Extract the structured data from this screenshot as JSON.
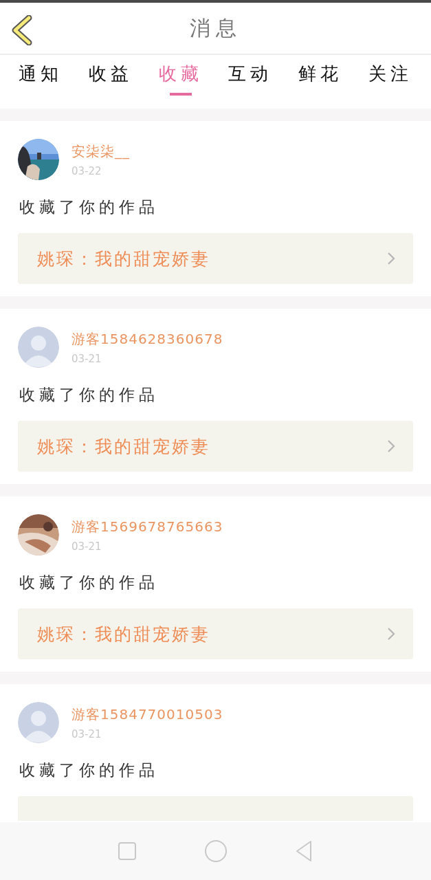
{
  "header": {
    "title": "消息"
  },
  "tabs": [
    {
      "label": "通知",
      "selected": false
    },
    {
      "label": "收益",
      "selected": false
    },
    {
      "label": "收藏",
      "selected": true
    },
    {
      "label": "互动",
      "selected": false
    },
    {
      "label": "鲜花",
      "selected": false
    },
    {
      "label": "关注",
      "selected": false
    }
  ],
  "messages": [
    {
      "name": "安柒柒__",
      "date": "03-22",
      "text": "收藏了你的作品",
      "work": {
        "title": "姚琛：我的甜宠娇妻"
      }
    },
    {
      "avatar": {
        "kind": "default"
      },
      "name": "游客1584628360678",
      "date": "03-21",
      "text": "收藏了你的作品",
      "work": {
        "title": "姚琛：我的甜宠娇妻"
      }
    },
    {
      "name": "游客1569678765663",
      "date": "03-21",
      "text": "收藏了你的作品",
      "work": {
        "title": "姚琛：我的甜宠娇妻"
      }
    },
    {
      "avatar": {
        "kind": "default"
      },
      "name": "游客1584770010503",
      "date": "03-21",
      "text": "收藏了你的作品",
      "work": {
        "covered": true
      }
    }
  ]
}
